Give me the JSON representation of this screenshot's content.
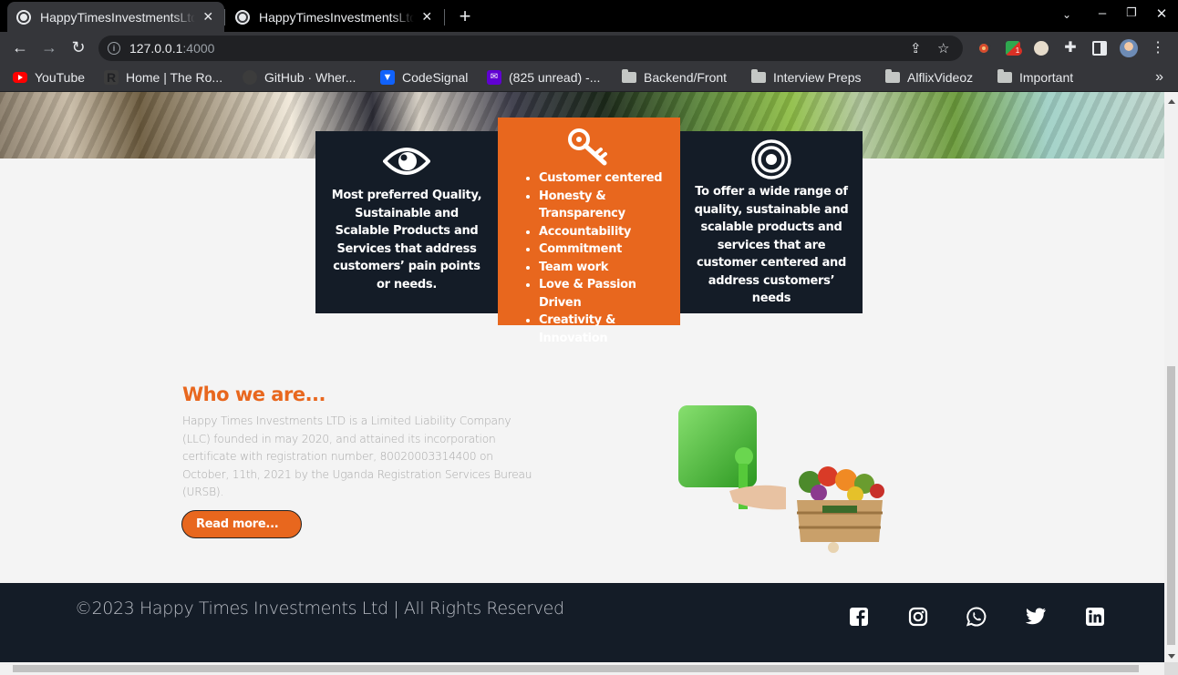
{
  "browser": {
    "tabs": [
      {
        "title": "HappyTimesInvestmentsLtd",
        "active": true
      },
      {
        "title": "HappyTimesInvestmentsLtd",
        "active": false
      }
    ],
    "url_host": "127.0.0.1",
    "url_port": ":4000",
    "bookmarks": [
      {
        "label": "YouTube",
        "icon": "youtube-icon",
        "color": "#ff0000"
      },
      {
        "label": "Home | The Ro...",
        "icon": "r-logo-icon",
        "color": "#3c3c3c"
      },
      {
        "label": "GitHub · Wher...",
        "icon": "github-icon",
        "color": "#3c3c3c"
      },
      {
        "label": "CodeSignal",
        "icon": "codesignal-icon",
        "color": "#1062fb"
      },
      {
        "label": "(825 unread) -...",
        "icon": "yahoo-mail-icon",
        "color": "#6001d2"
      },
      {
        "label": "Backend/Front",
        "icon": "folder-icon"
      },
      {
        "label": "Interview Preps",
        "icon": "folder-icon"
      },
      {
        "label": "AlflixVideoz",
        "icon": "folder-icon"
      },
      {
        "label": "Important",
        "icon": "folder-icon"
      }
    ],
    "more_bookmarks": "»",
    "extension_badge": "1"
  },
  "cards": {
    "vision": {
      "icon": "eye-icon",
      "text": "Most preferred Quality, Sustainable and Scalable Products and Services that address customers’ pain points or needs."
    },
    "values": {
      "icon": "key-icon",
      "items": [
        "Customer centered",
        "Honesty & Transparency",
        "Accountability",
        "Commitment",
        "Team work",
        "Love & Passion Driven",
        "Creativity & Innovation"
      ]
    },
    "mission": {
      "icon": "target-icon",
      "text": "To offer a wide range of quality, sustainable and scalable products and services that are customer centered and address customers’ needs"
    }
  },
  "about": {
    "title": "Who we are...",
    "text": "Happy Times Investments LTD is a Limited Liability Company (LLC) founded in may 2020, and attained its incorporation certificate with registration number, 80020003314400 on October, 11th, 2021 by the Uganda Registration Services Bureau (URSB).",
    "button": "Read more..."
  },
  "footer": {
    "copyright": "©2023 Happy Times Investments Ltd | All Rights Reserved",
    "social": [
      "facebook-icon",
      "instagram-icon",
      "whatsapp-icon",
      "twitter-icon",
      "linkedin-icon"
    ]
  },
  "colors": {
    "accent": "#e8671e",
    "dark": "#141c27",
    "page_bg": "#f4f4f4"
  }
}
